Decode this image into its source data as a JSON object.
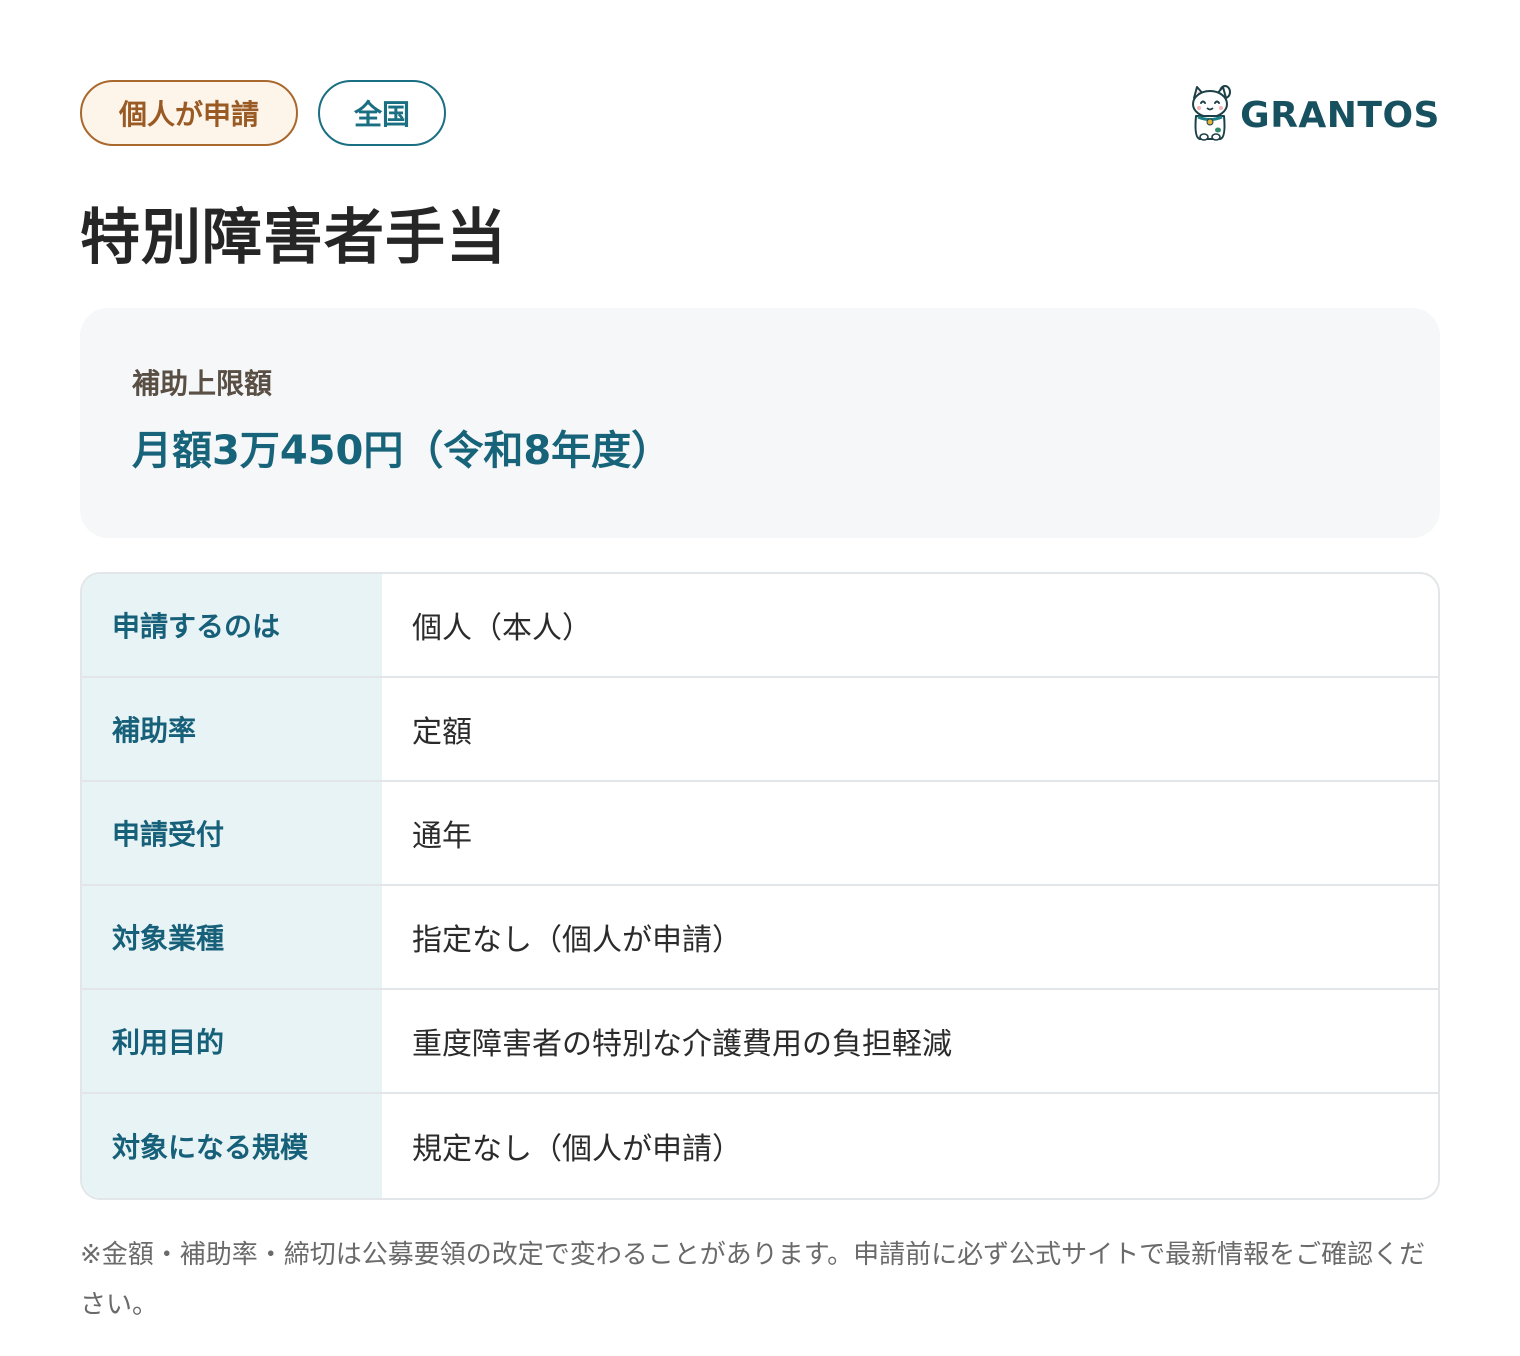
{
  "tags": {
    "applicant": "個人が申請",
    "region": "全国"
  },
  "brand": {
    "name": "GRANTOS",
    "logo_icon": "lucky-cat-icon"
  },
  "title": "特別障害者手当",
  "amount": {
    "label": "補助上限額",
    "value": "月額3万450円（令和8年度）"
  },
  "details": [
    {
      "key": "申請するのは",
      "value": "個人（本人）"
    },
    {
      "key": "補助率",
      "value": "定額"
    },
    {
      "key": "申請受付",
      "value": "通年"
    },
    {
      "key": "対象業種",
      "value": "指定なし（個人が申請）"
    },
    {
      "key": "利用目的",
      "value": "重度障害者の特別な介護費用の負担軽減"
    },
    {
      "key": "対象になる規模",
      "value": "規定なし（個人が申請）"
    }
  ],
  "footnote": "※金額・補助率・締切は公募要領の改定で変わることがあります。申請前に必ず公式サイトで最新情報をご確認ください。",
  "colors": {
    "accent_teal": "#16637a",
    "tag_brown": "#9a5a24",
    "key_background": "#e8f3f5",
    "card_background": "#f5f7f8"
  }
}
